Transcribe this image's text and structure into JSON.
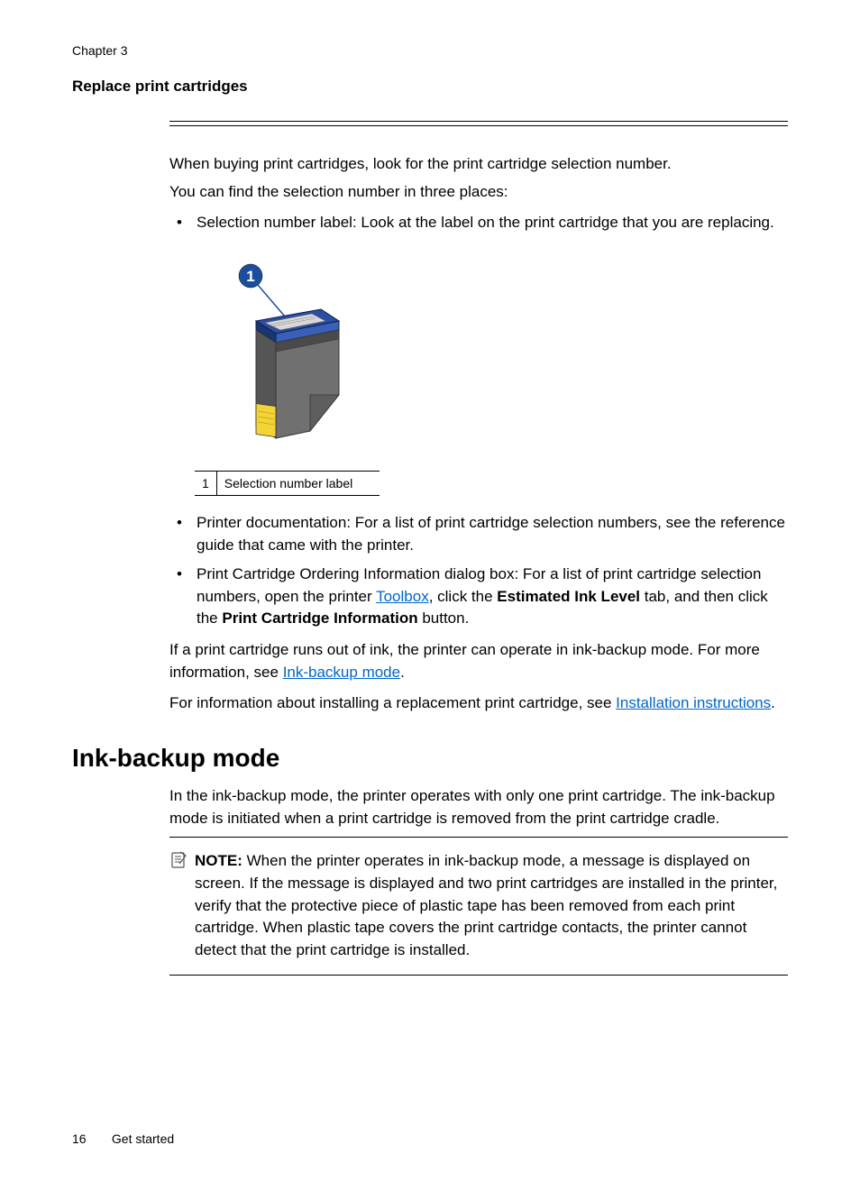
{
  "chapter": "Chapter 3",
  "section_heading": "Replace print cartridges",
  "intro1": "When buying print cartridges, look for the print cartridge selection number.",
  "intro2": "You can find the selection number in three places:",
  "bullet1": "Selection number label: Look at the label on the print cartridge that you are replacing.",
  "callout_number": "1",
  "figure_caption_num": "1",
  "figure_caption_text": "Selection number label",
  "bullet2": "Printer documentation: For a list of print cartridge selection numbers, see the reference guide that came with the printer.",
  "bullet3_pre": "Print Cartridge Ordering Information dialog box: For a list of print cartridge selection numbers, open the printer ",
  "bullet3_link1": "Toolbox",
  "bullet3_mid1": ", click the ",
  "bullet3_b1": "Estimated Ink Level",
  "bullet3_mid2": " tab, and then click the ",
  "bullet3_b2": "Print Cartridge Information",
  "bullet3_end": " button.",
  "para_after1_pre": "If a print cartridge runs out of ink, the printer can operate in ink-backup mode. For more information, see ",
  "para_after1_link": "Ink-backup mode",
  "dot": ".",
  "para_after2_pre": "For information about installing a replacement print cartridge, see ",
  "para_after2_link": "Installation instructions",
  "heading2": "Ink-backup mode",
  "h2_para": "In the ink-backup mode, the printer operates with only one print cartridge. The ink-backup mode is initiated when a print cartridge is removed from the print cartridge cradle.",
  "note_label": "NOTE:",
  "note_text": "  When the printer operates in ink-backup mode, a message is displayed on screen. If the message is displayed and two print cartridges are installed in the printer, verify that the protective piece of plastic tape has been removed from each print cartridge. When plastic tape covers the print cartridge contacts, the printer cannot detect that the print cartridge is installed.",
  "footer_page": "16",
  "footer_title": "Get started"
}
